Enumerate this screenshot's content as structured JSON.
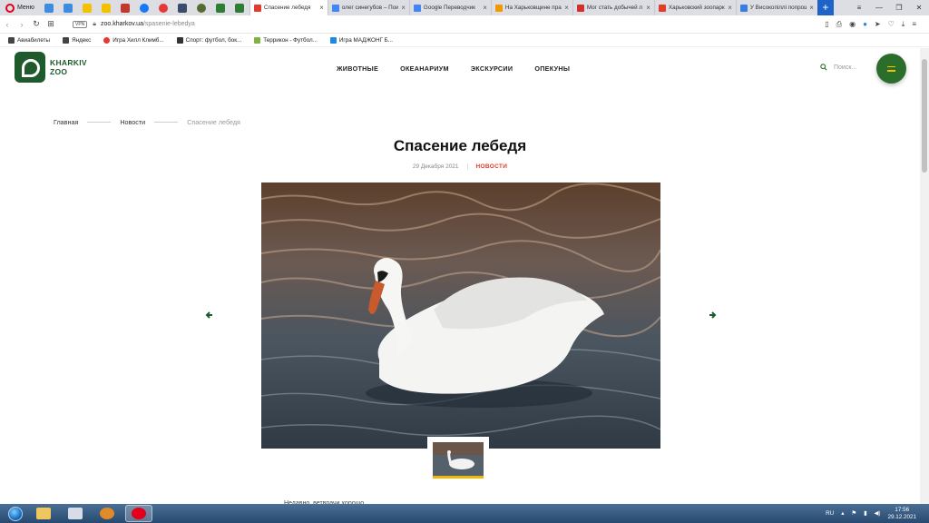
{
  "browser": {
    "menu_label": "Меню",
    "tabs": [
      {
        "title": "Спасение лебедя",
        "active": true,
        "fav": "#e23b2a"
      },
      {
        "title": "олег синегубов – Пои",
        "active": false,
        "fav": "#4285f4"
      },
      {
        "title": "Google Переводчик",
        "active": false,
        "fav": "#4285f4"
      },
      {
        "title": "На Харьковщине пра",
        "active": false,
        "fav": "#f29900"
      },
      {
        "title": "Мог стать добычей л",
        "active": false,
        "fav": "#d32f2f"
      },
      {
        "title": "Харьковский зоопарк",
        "active": false,
        "fav": "#e23b2a"
      },
      {
        "title": "У Високопіллі попрош",
        "active": false,
        "fav": "#3b7ddd"
      }
    ],
    "url_host": "zoo.kharkov.ua",
    "url_path": "/spasenie-lebedya",
    "vpn_label": "VPN",
    "bookmarks": [
      {
        "label": "Авиабилеты",
        "color": "#444"
      },
      {
        "label": "Яндекс",
        "color": "#444"
      },
      {
        "label": "Игра Хилл Климб...",
        "color": "#e53935"
      },
      {
        "label": "Спорт: футбол, бок...",
        "color": "#333"
      },
      {
        "label": "Террикон - Футбол...",
        "color": "#7cb342"
      },
      {
        "label": "Игра МАДЖОНГ Б...",
        "color": "#1e88e5"
      }
    ]
  },
  "site": {
    "logo_line1": "KHARKIV",
    "logo_line2": "ZOO",
    "nav": [
      "ЖИВОТНЫЕ",
      "ОКЕАНАРИУМ",
      "ЭКСКУРСИИ",
      "ОПЕКУНЫ"
    ],
    "search_placeholder": "Поиск...",
    "accent_green": "#2b6e2b",
    "accent_red": "#e23b2a"
  },
  "breadcrumb": [
    "Главная",
    "Новости",
    "Спасение лебедя"
  ],
  "article": {
    "title": "Спасение лебедя",
    "date": "29 Декабря 2021",
    "category": "НОВОСТИ",
    "body_start": "Недавно, ветврачи хорошо ..."
  },
  "taskbar": {
    "lang": "RU",
    "time": "17:56",
    "date": "29.12.2021"
  }
}
